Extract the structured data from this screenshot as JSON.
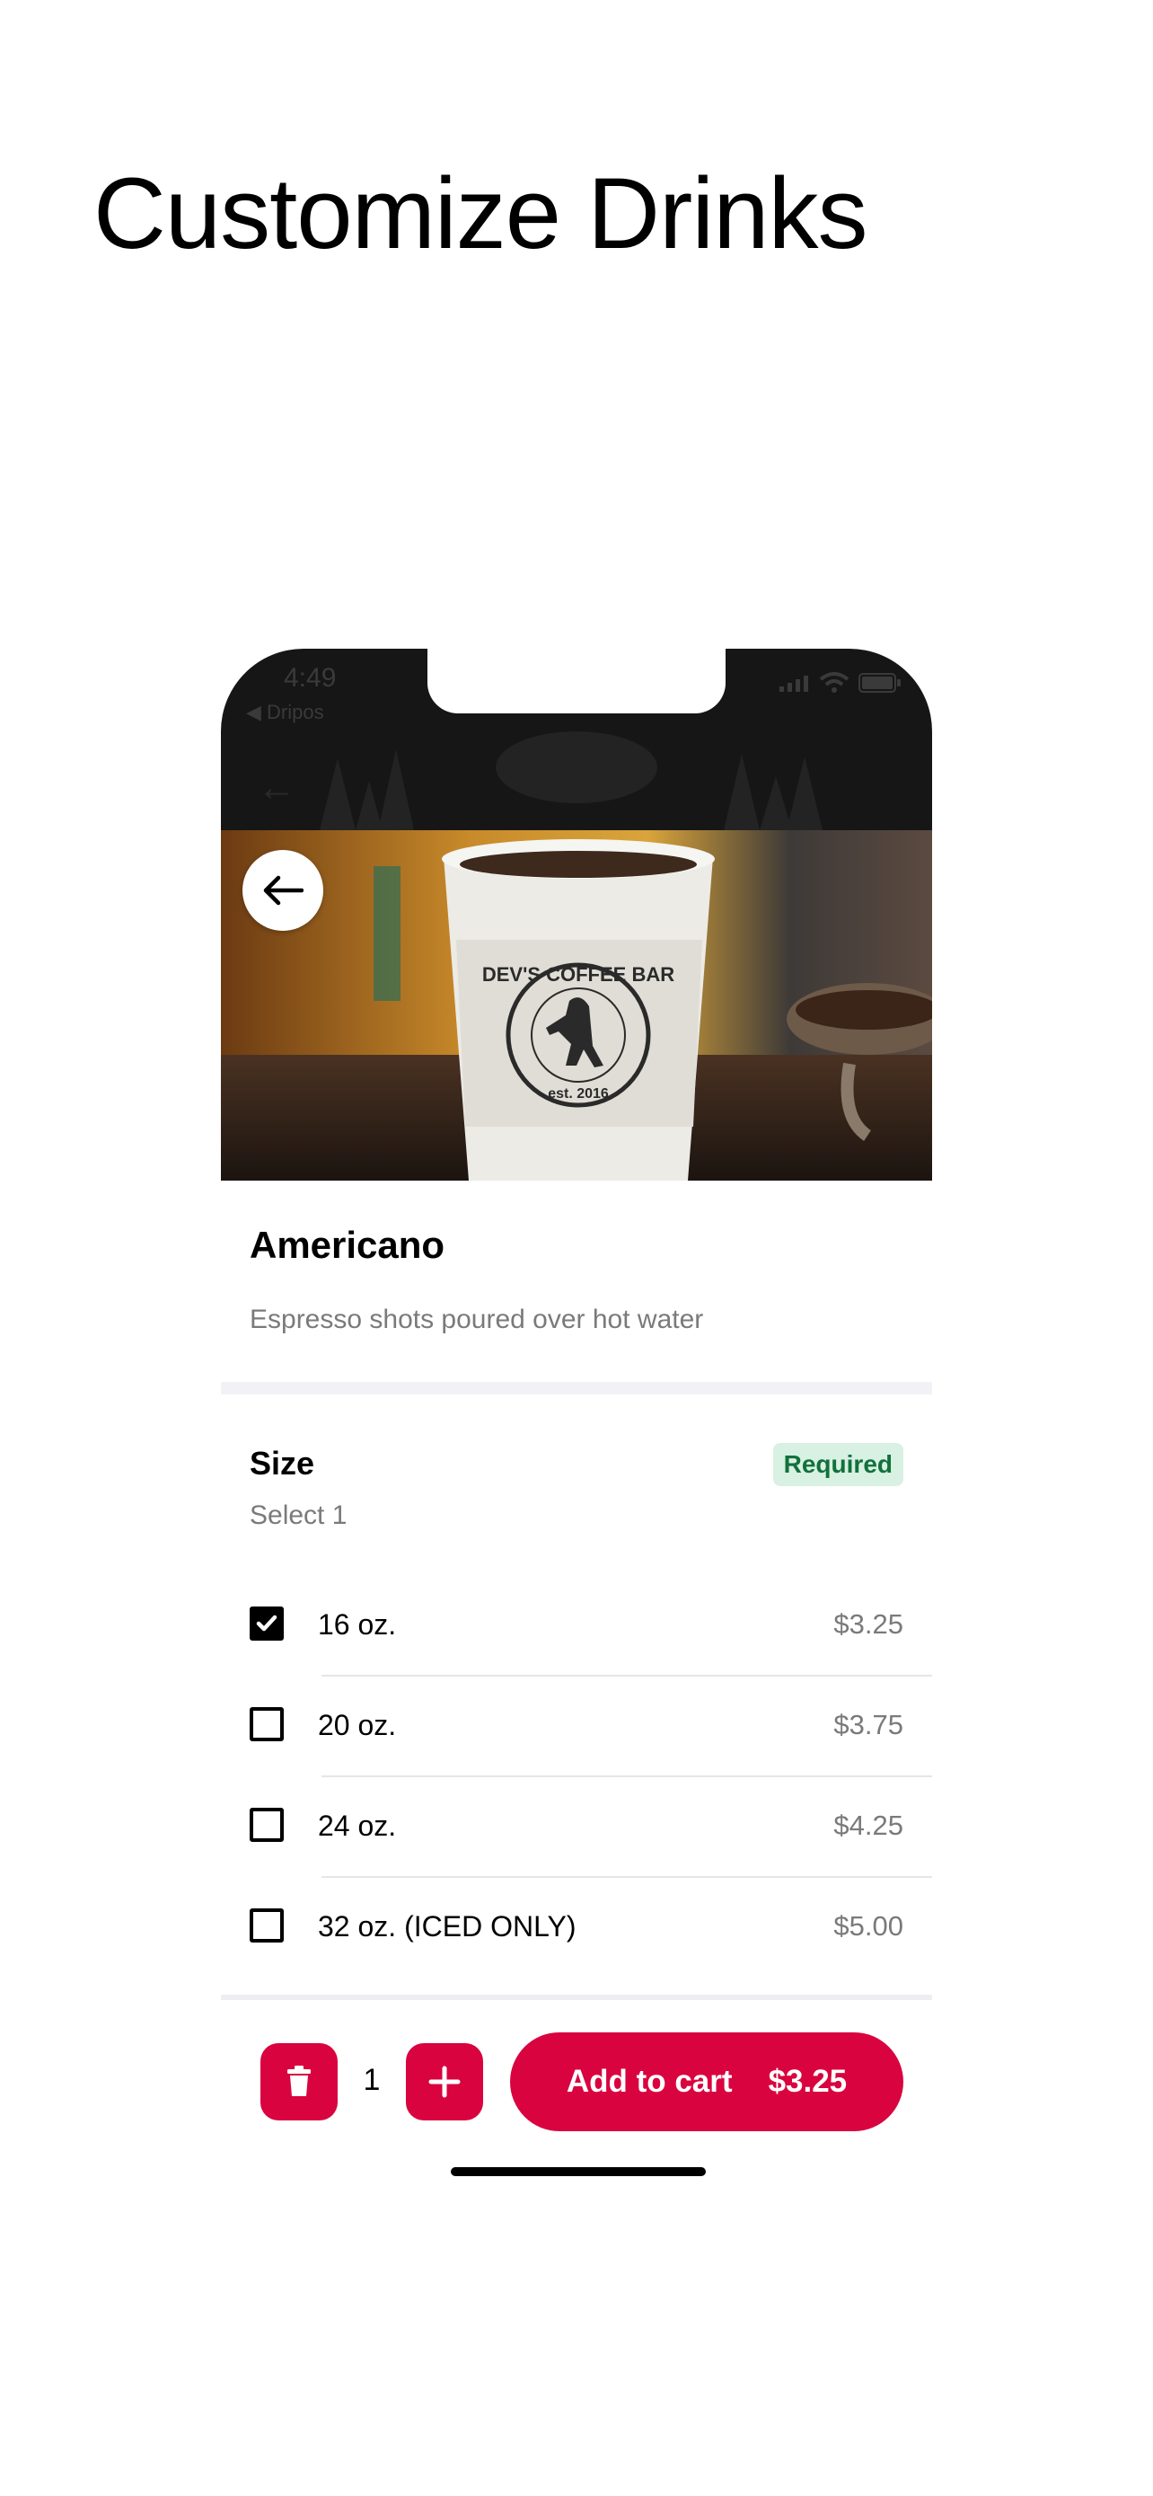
{
  "page": {
    "title": "Customize Drinks"
  },
  "status_bar": {
    "time": "4:49",
    "back_app": "◀ Dripos"
  },
  "product": {
    "name": "Americano",
    "description": "Espresso shots poured over hot water",
    "cup_text": "DEV'S COFFEE BAR",
    "cup_est": "est. 2016"
  },
  "size_group": {
    "title": "Size",
    "subtitle": "Select 1",
    "badge": "Required",
    "options": [
      {
        "label": "16 oz.",
        "price": "$3.25",
        "checked": true
      },
      {
        "label": "20 oz.",
        "price": "$3.75",
        "checked": false
      },
      {
        "label": "24 oz.",
        "price": "$4.25",
        "checked": false
      },
      {
        "label": "32 oz. (ICED ONLY)",
        "price": "$5.00",
        "checked": false
      }
    ]
  },
  "cart": {
    "quantity": "1",
    "add_label": "Add to cart",
    "total": "$3.25"
  },
  "colors": {
    "accent": "#d9043f",
    "badge_bg": "#d8f1e2",
    "badge_text": "#12713c",
    "muted_text": "#7a7a7a"
  }
}
